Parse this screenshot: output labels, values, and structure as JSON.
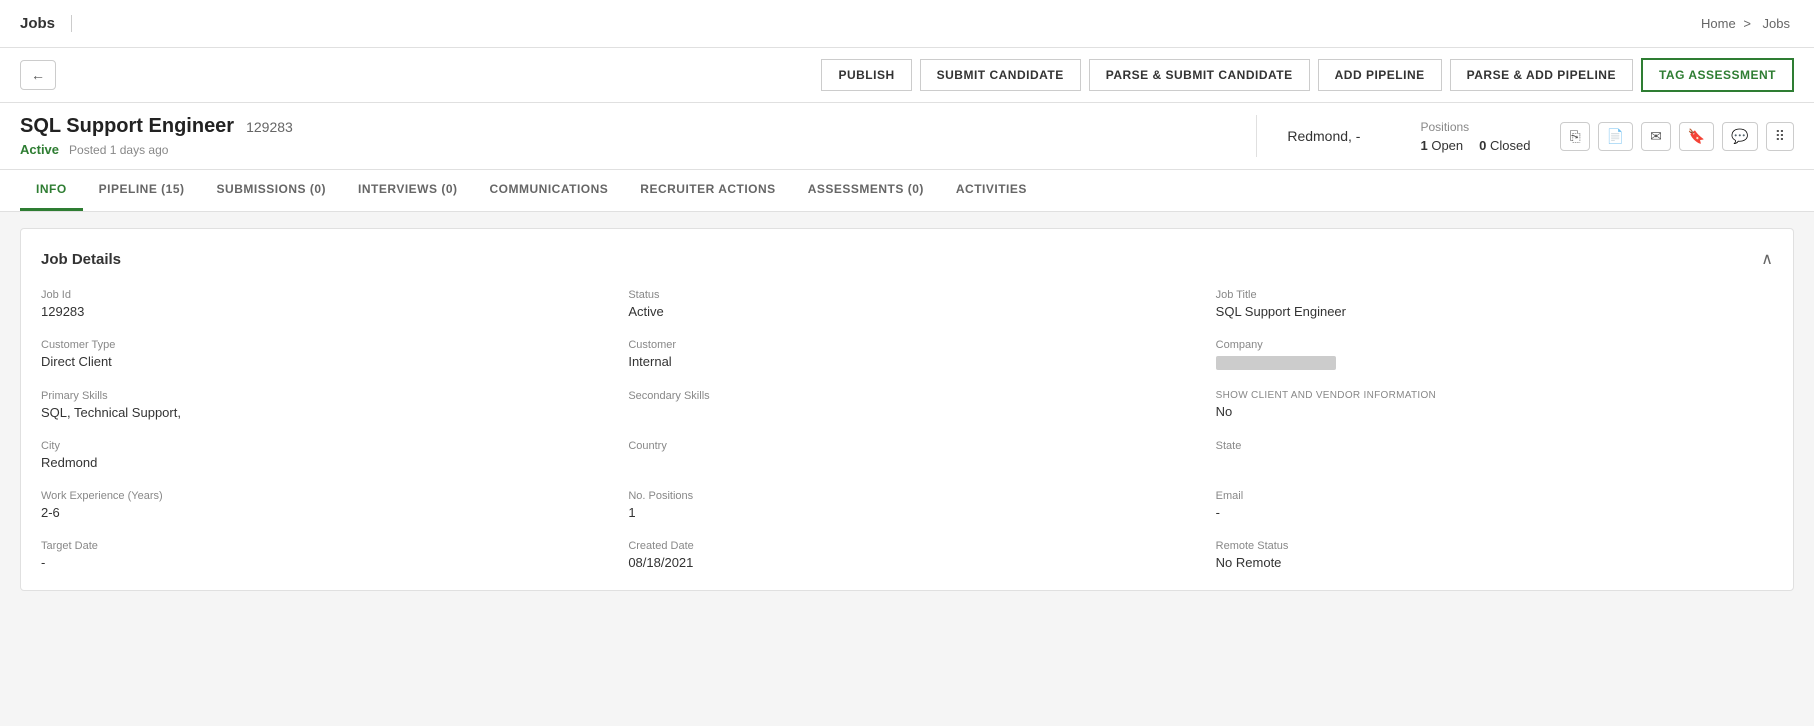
{
  "topNav": {
    "appTitle": "Jobs",
    "breadcrumb": {
      "home": "Home",
      "separator": ">",
      "current": "Jobs"
    }
  },
  "toolbar": {
    "backIcon": "←",
    "buttons": [
      {
        "id": "publish",
        "label": "PUBLISH"
      },
      {
        "id": "submit-candidate",
        "label": "SUBMIT CANDIDATE"
      },
      {
        "id": "parse-submit-candidate",
        "label": "PARSE & SUBMIT CANDIDATE"
      },
      {
        "id": "add-pipeline",
        "label": "ADD PIPELINE"
      },
      {
        "id": "parse-add-pipeline",
        "label": "PARSE & ADD PIPELINE"
      },
      {
        "id": "tag-assessment",
        "label": "TAG ASSESSMENT",
        "active": true
      }
    ]
  },
  "job": {
    "title": "SQL Support Engineer",
    "id": "129283",
    "status": "Active",
    "postedTime": "Posted 1 days ago",
    "location": "Redmond, -",
    "positions": {
      "label": "Positions",
      "open": "1",
      "openLabel": "Open",
      "closed": "0",
      "closedLabel": "Closed"
    }
  },
  "iconButtons": [
    {
      "id": "copy-icon",
      "symbol": "⎘"
    },
    {
      "id": "document-icon",
      "symbol": "📄"
    },
    {
      "id": "mail-icon",
      "symbol": "✉"
    },
    {
      "id": "bookmark-icon",
      "symbol": "🔖"
    },
    {
      "id": "chat-icon",
      "symbol": "💬"
    },
    {
      "id": "tree-icon",
      "symbol": "⠿"
    }
  ],
  "tabs": [
    {
      "id": "info",
      "label": "INFO",
      "active": true
    },
    {
      "id": "pipeline",
      "label": "PIPELINE (15)"
    },
    {
      "id": "submissions",
      "label": "SUBMISSIONS (0)"
    },
    {
      "id": "interviews",
      "label": "INTERVIEWS (0)"
    },
    {
      "id": "communications",
      "label": "COMMUNICATIONS"
    },
    {
      "id": "recruiter-actions",
      "label": "RECRUITER ACTIONS"
    },
    {
      "id": "assessments",
      "label": "ASSESSMENTS (0)"
    },
    {
      "id": "activities",
      "label": "ACTIVITIES"
    }
  ],
  "jobDetails": {
    "title": "Job Details",
    "collapseIcon": "∧",
    "fields": [
      {
        "row": 0,
        "items": [
          {
            "id": "job-id",
            "label": "Job Id",
            "value": "129283"
          },
          {
            "id": "status",
            "label": "Status",
            "value": "Active"
          },
          {
            "id": "job-title",
            "label": "Job Title",
            "value": "SQL Support Engineer"
          }
        ]
      },
      {
        "row": 1,
        "items": [
          {
            "id": "customer-type",
            "label": "Customer Type",
            "value": "Direct Client"
          },
          {
            "id": "customer",
            "label": "Customer",
            "value": "Internal"
          },
          {
            "id": "company",
            "label": "Company",
            "value": "BLURRED"
          }
        ]
      },
      {
        "row": 2,
        "items": [
          {
            "id": "primary-skills",
            "label": "Primary Skills",
            "value": "SQL, Technical Support,"
          },
          {
            "id": "secondary-skills",
            "label": "Secondary Skills",
            "value": ""
          },
          {
            "id": "show-client",
            "label": "SHOW CLIENT AND VENDOR INFORMATION",
            "value": "No"
          }
        ]
      },
      {
        "row": 3,
        "items": [
          {
            "id": "city",
            "label": "City",
            "value": "Redmond"
          },
          {
            "id": "country",
            "label": "Country",
            "value": ""
          },
          {
            "id": "state",
            "label": "State",
            "value": ""
          }
        ]
      },
      {
        "row": 4,
        "items": [
          {
            "id": "work-experience",
            "label": "Work Experience (Years)",
            "value": "2-6"
          },
          {
            "id": "no-positions",
            "label": "No. Positions",
            "value": "1"
          },
          {
            "id": "email",
            "label": "Email",
            "value": "-"
          }
        ]
      },
      {
        "row": 5,
        "items": [
          {
            "id": "target-date",
            "label": "Target Date",
            "value": "-"
          },
          {
            "id": "created-date",
            "label": "Created Date",
            "value": "08/18/2021"
          },
          {
            "id": "remote-status",
            "label": "Remote Status",
            "value": "No Remote"
          }
        ]
      }
    ]
  }
}
